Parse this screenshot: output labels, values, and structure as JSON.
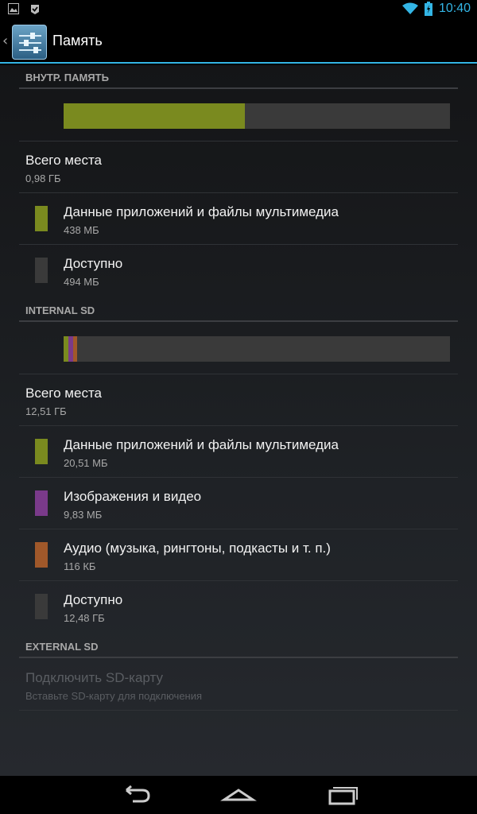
{
  "status_bar": {
    "time": "10:40",
    "left_icons": [
      "gallery-icon",
      "check-badge-icon"
    ],
    "right_icons": [
      "wifi-icon",
      "battery-charging-icon"
    ]
  },
  "action_bar": {
    "title": "Память",
    "icon": "settings-sliders-icon",
    "back": "‹"
  },
  "sections": {
    "internal": {
      "header": "ВНУТР. ПАМЯТЬ",
      "total_label": "Всего места",
      "total_value": "0,98 ГБ",
      "apps_label": "Данные приложений и файлы мультимедиа",
      "apps_value": "438 МБ",
      "free_label": "Доступно",
      "free_value": "494 МБ",
      "bar_fractions": {
        "apps": 0.47
      }
    },
    "internal_sd": {
      "header": "INTERNAL SD",
      "total_label": "Всего места",
      "total_value": "12,51 ГБ",
      "apps_label": "Данные приложений и файлы мультимедиа",
      "apps_value": "20,51 МБ",
      "images_label": "Изображения и видео",
      "images_value": "9,83 МБ",
      "audio_label": "Аудио (музыка, рингтоны, подкасты и т. п.)",
      "audio_value": "116 КБ",
      "free_label": "Доступно",
      "free_value": "12,48 ГБ",
      "bar_fractions": {
        "apps": 0.012,
        "images": 0.012,
        "audio": 0.012
      }
    },
    "external_sd": {
      "header": "EXTERNAL SD",
      "mount_label": "Подключить SD-карту",
      "mount_hint": "Вставьте SD-карту для подключения"
    }
  },
  "colors": {
    "accent": "#33b5e5",
    "apps": "#7a8a1f",
    "images": "#7a3a8a",
    "audio": "#a0582a",
    "free": "#3a3a3a"
  },
  "nav_bar": {
    "buttons": [
      "back-icon",
      "home-icon",
      "recent-apps-icon"
    ]
  }
}
